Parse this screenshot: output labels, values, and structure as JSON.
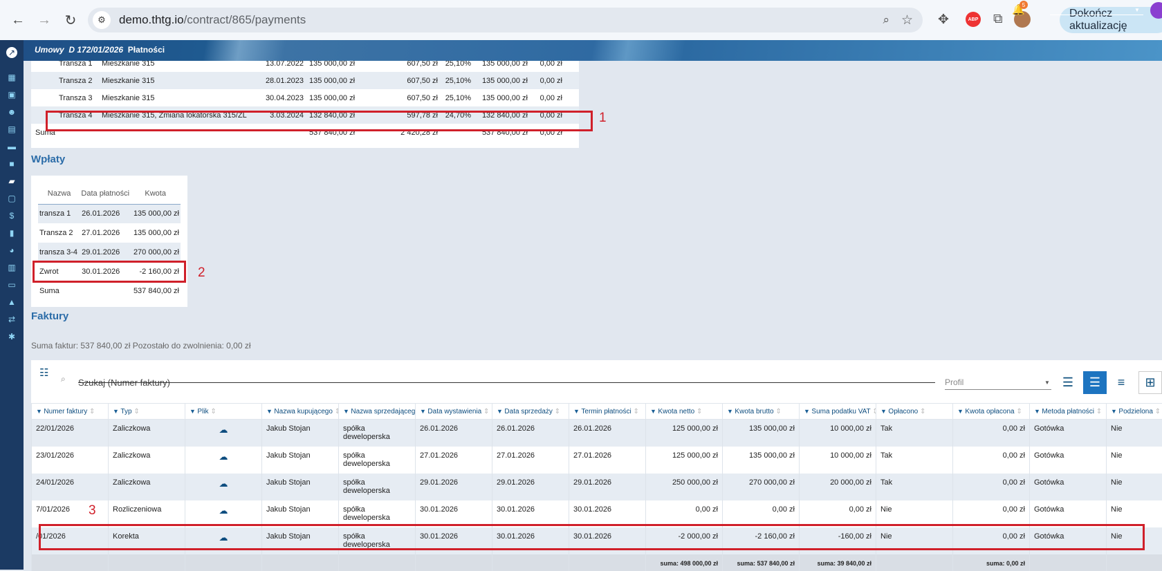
{
  "browser": {
    "url_host": "demo.thtg.io",
    "url_path": "/contract/865/payments",
    "update_label": "Dokończ aktualizację"
  },
  "appbar": {
    "module": "Umowy",
    "contract": "D 172/01/2026",
    "page": "Płatności",
    "notifications": "5"
  },
  "tranches": {
    "rows": [
      {
        "name": "Transza 1",
        "desc": "Mieszkanie 315",
        "date": "13.07.2022",
        "amount": "135 000,00 zł",
        "fee": "607,50 zł",
        "pct": "25,10%",
        "paid": "135 000,00 zł",
        "rest": "0,00 zł"
      },
      {
        "name": "Transza 2",
        "desc": "Mieszkanie 315",
        "date": "28.01.2023",
        "amount": "135 000,00 zł",
        "fee": "607,50 zł",
        "pct": "25,10%",
        "paid": "135 000,00 zł",
        "rest": "0,00 zł"
      },
      {
        "name": "Transza 3",
        "desc": "Mieszkanie 315",
        "date": "30.04.2023",
        "amount": "135 000,00 zł",
        "fee": "607,50 zł",
        "pct": "25,10%",
        "paid": "135 000,00 zł",
        "rest": "0,00 zł"
      },
      {
        "name": "Transza 4",
        "desc": "Mieszkanie 315, Zmiana lokatorska 315/ZL",
        "date": "3.03.2024",
        "amount": "132 840,00 zł",
        "fee": "597,78 zł",
        "pct": "24,70%",
        "paid": "132 840,00 zł",
        "rest": "0,00 zł"
      }
    ],
    "sum": {
      "label": "Suma",
      "amount": "537 840,00 zł",
      "fee": "2 420,28 zł",
      "paid": "537 840,00 zł",
      "rest": "0,00 zł"
    }
  },
  "wplaty": {
    "title": "Wpłaty",
    "headers": [
      "Nazwa",
      "Data płatności",
      "Kwota"
    ],
    "rows": [
      {
        "name": "transza 1",
        "date": "26.01.2026",
        "amount": "135 000,00 zł"
      },
      {
        "name": "Transza 2",
        "date": "27.01.2026",
        "amount": "135 000,00 zł"
      },
      {
        "name": "transza 3-4",
        "date": "29.01.2026",
        "amount": "270 000,00 zł"
      },
      {
        "name": "Zwrot",
        "date": "30.01.2026",
        "amount": "-2 160,00 zł"
      }
    ],
    "sum": {
      "label": "Suma",
      "amount": "537 840,00 zł"
    }
  },
  "faktury": {
    "title": "Faktury",
    "info": "Suma faktur: 537 840,00 zł  Pozostało do zwolnienia: 0,00 zł",
    "search_placeholder": "Szukaj (Numer faktury)",
    "profile_label": "Profil",
    "headers": [
      "Numer faktury",
      "Typ",
      "Plik",
      "Nazwa kupującego",
      "Nazwa sprzedającego",
      "Data wystawienia",
      "Data sprzedaży",
      "Termin płatności",
      "Kwota netto",
      "Kwota brutto",
      "Suma podatku VAT",
      "Opłacono",
      "Kwota opłacona",
      "Metoda płatności",
      "Podzielona"
    ],
    "rows": [
      {
        "nr": "22/01/2026",
        "typ": "Zaliczkowa",
        "buyer": "Jakub Stojan",
        "seller": "spółka deweloperska",
        "d1": "26.01.2026",
        "d2": "26.01.2026",
        "d3": "26.01.2026",
        "net": "125 000,00 zł",
        "gross": "135 000,00 zł",
        "vat": "10 000,00 zł",
        "paid": "Tak",
        "paid_amt": "0,00 zł",
        "method": "Gotówka",
        "split": "Nie"
      },
      {
        "nr": "23/01/2026",
        "typ": "Zaliczkowa",
        "buyer": "Jakub Stojan",
        "seller": "spółka deweloperska",
        "d1": "27.01.2026",
        "d2": "27.01.2026",
        "d3": "27.01.2026",
        "net": "125 000,00 zł",
        "gross": "135 000,00 zł",
        "vat": "10 000,00 zł",
        "paid": "Tak",
        "paid_amt": "0,00 zł",
        "method": "Gotówka",
        "split": "Nie"
      },
      {
        "nr": "24/01/2026",
        "typ": "Zaliczkowa",
        "buyer": "Jakub Stojan",
        "seller": "spółka deweloperska",
        "d1": "29.01.2026",
        "d2": "29.01.2026",
        "d3": "29.01.2026",
        "net": "250 000,00 zł",
        "gross": "270 000,00 zł",
        "vat": "20 000,00 zł",
        "paid": "Tak",
        "paid_amt": "0,00 zł",
        "method": "Gotówka",
        "split": "Nie"
      },
      {
        "nr": "7/01/2026",
        "typ": "Rozliczeniowa",
        "buyer": "Jakub Stojan",
        "seller": "spółka deweloperska",
        "d1": "30.01.2026",
        "d2": "30.01.2026",
        "d3": "30.01.2026",
        "net": "0,00 zł",
        "gross": "0,00 zł",
        "vat": "0,00 zł",
        "paid": "Nie",
        "paid_amt": "0,00 zł",
        "method": "Gotówka",
        "split": "Nie"
      },
      {
        "nr": "/01/2026",
        "typ": "Korekta",
        "buyer": "Jakub Stojan",
        "seller": "spółka deweloperska",
        "d1": "30.01.2026",
        "d2": "30.01.2026",
        "d3": "30.01.2026",
        "net": "-2 000,00 zł",
        "gross": "-2 160,00 zł",
        "vat": "-160,00 zł",
        "paid": "Nie",
        "paid_amt": "0,00 zł",
        "method": "Gotówka",
        "split": "Nie"
      }
    ],
    "sums": {
      "net": "suma: 498 000,00 zł",
      "gross": "suma: 537 840,00 zł",
      "vat": "suma: 39 840,00 zł",
      "paid": "suma: 0,00 zł"
    }
  },
  "annotations": {
    "one": "1",
    "two": "2",
    "three": "3"
  },
  "colors": {
    "accent": "#2b6ca8",
    "highlight": "#d0202a",
    "sidebar": "#1b3a63"
  },
  "icons": {
    "file": "cloud-download-icon",
    "filter": "filter-icon"
  }
}
